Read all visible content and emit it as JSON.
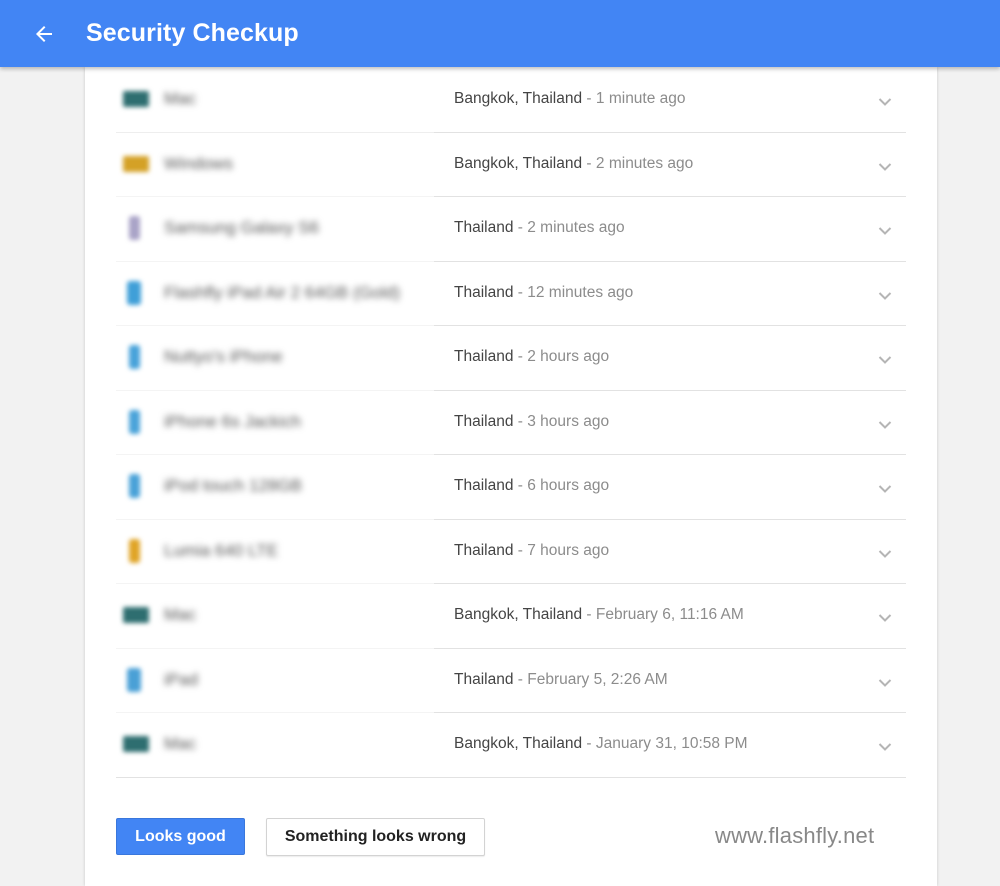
{
  "header": {
    "title": "Security Checkup",
    "back_icon": "arrow-back-icon",
    "color": "#4285f4"
  },
  "devices": [
    {
      "icon": "laptop-icon",
      "icon_color": "#2e6e70",
      "name": "Mac",
      "place": "Bangkok, Thailand",
      "separator": " - ",
      "time": "1 minute ago"
    },
    {
      "icon": "laptop-icon",
      "icon_color": "#d4a126",
      "name": "Windows",
      "place": "Bangkok, Thailand",
      "separator": " - ",
      "time": "2 minutes ago"
    },
    {
      "icon": "phone-icon",
      "icon_color": "#a9a3c7",
      "name": "Samsung Galaxy S6",
      "place": "Thailand",
      "separator": " - ",
      "time": "2 minutes ago"
    },
    {
      "icon": "tablet-icon",
      "icon_color": "#3f9fd8",
      "name": "Flashfly iPad Air 2 64GB (Gold)",
      "place": "Thailand",
      "separator": " - ",
      "time": "12 minutes ago"
    },
    {
      "icon": "phone-icon",
      "icon_color": "#47a2da",
      "name": "Nuttyo's iPhone",
      "place": "Thailand",
      "separator": " - ",
      "time": "2 hours ago"
    },
    {
      "icon": "phone-icon",
      "icon_color": "#4aa3d9",
      "name": "iPhone 6s Jackich",
      "place": "Thailand",
      "separator": " - ",
      "time": "3 hours ago"
    },
    {
      "icon": "phone-icon",
      "icon_color": "#48a1d8",
      "name": "iPod touch 128GB",
      "place": "Thailand",
      "separator": " - ",
      "time": "6 hours ago"
    },
    {
      "icon": "phone-icon",
      "icon_color": "#e0a426",
      "name": "Lumia 640 LTE",
      "place": "Thailand",
      "separator": " - ",
      "time": "7 hours ago"
    },
    {
      "icon": "laptop-icon",
      "icon_color": "#2e6e70",
      "name": "Mac",
      "place": "Bangkok, Thailand",
      "separator": " - ",
      "time": "February 6, 11:16 AM"
    },
    {
      "icon": "tablet-icon",
      "icon_color": "#4aa0d6",
      "name": "iPad",
      "place": "Thailand",
      "separator": " - ",
      "time": "February 5, 2:26 AM"
    },
    {
      "icon": "laptop-icon",
      "icon_color": "#2e6e70",
      "name": "Mac",
      "place": "Bangkok, Thailand",
      "separator": " - ",
      "time": "January 31, 10:58 PM"
    }
  ],
  "actions": {
    "looks_good": "Looks good",
    "looks_wrong": "Something looks wrong"
  },
  "watermark": "www.flashfly.net"
}
